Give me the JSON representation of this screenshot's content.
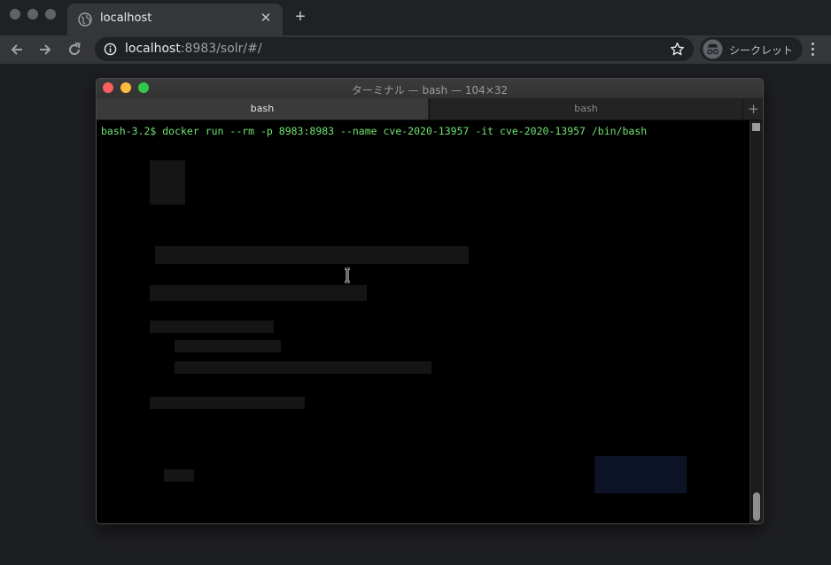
{
  "browser": {
    "tab": {
      "title": "localhost"
    },
    "address": {
      "host": "localhost",
      "rest": ":8983/solr/#/"
    },
    "incognito_label": "シークレット"
  },
  "terminal": {
    "window_title": "ターミナル — bash — 104×32",
    "tabs": [
      {
        "label": "bash",
        "active": true
      },
      {
        "label": "bash",
        "active": false
      }
    ],
    "new_tab_label": "+",
    "command_line": "bash-3.2$ docker run --rm -p 8983:8983 --name cve-2020-13957 -it cve-2020-13957 /bin/bash"
  },
  "colors": {
    "prompt": "#6fe36f",
    "close": "#fc605c",
    "minimize": "#fdbc40",
    "maximize": "#34c84a"
  },
  "icons": {
    "back": "back-arrow-icon",
    "forward": "forward-arrow-icon",
    "reload": "reload-icon",
    "info": "info-icon",
    "bookmark": "star-icon",
    "incognito": "incognito-icon",
    "menu": "kebab-menu-icon",
    "tab_favicon": "globe-icon",
    "cursor": "text-cursor-icon"
  }
}
